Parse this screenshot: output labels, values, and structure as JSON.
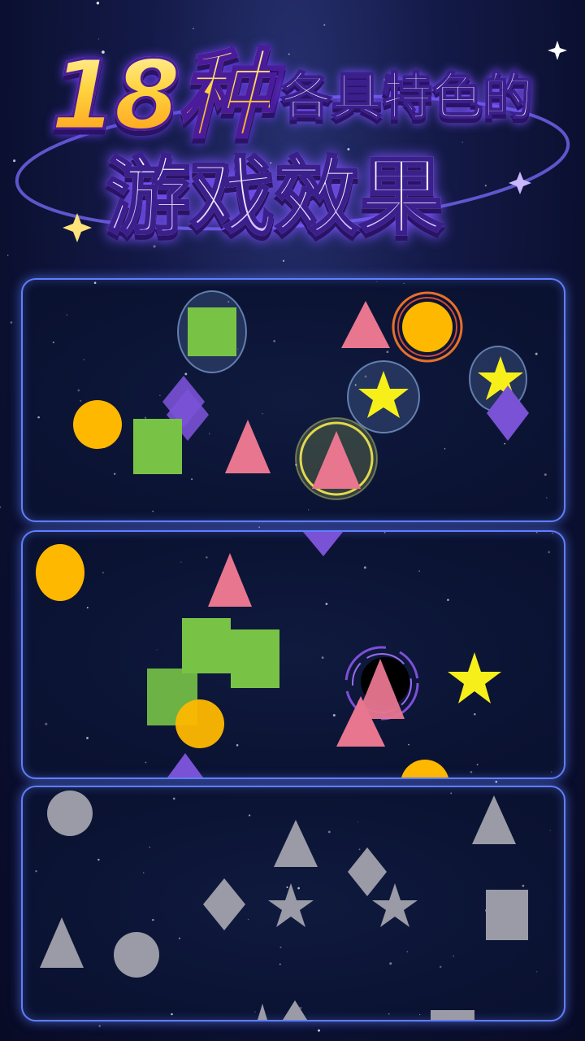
{
  "header": {
    "count_label": "18种",
    "subtitle": "各具特色的",
    "title": "游戏效果"
  },
  "colors": {
    "yellow": "#ffb800",
    "green": "#78c346",
    "pink": "#e8768f",
    "purple": "#7a52d6",
    "star": "#f7ef1a",
    "gray": "#9a9ba6",
    "panel_border": "#5f7fff"
  },
  "panels": [
    {
      "name": "effect-panel-1",
      "shapes": [
        {
          "type": "square",
          "color": "green",
          "effect": "bubble"
        },
        {
          "type": "triangle",
          "color": "pink"
        },
        {
          "type": "circle",
          "color": "yellow",
          "effect": "orange-ring"
        },
        {
          "type": "star",
          "color": "star",
          "effect": "bubble"
        },
        {
          "type": "star",
          "color": "star",
          "effect": "bubble"
        },
        {
          "type": "diamond",
          "color": "purple"
        },
        {
          "type": "diamond",
          "color": "purple"
        },
        {
          "type": "circle",
          "color": "yellow"
        },
        {
          "type": "square",
          "color": "green"
        },
        {
          "type": "triangle",
          "color": "pink"
        },
        {
          "type": "triangle",
          "color": "pink",
          "effect": "yellow-ring"
        }
      ]
    },
    {
      "name": "effect-panel-2",
      "shapes": [
        {
          "type": "circle",
          "color": "yellow"
        },
        {
          "type": "diamond",
          "color": "purple"
        },
        {
          "type": "triangle",
          "color": "pink"
        },
        {
          "type": "square",
          "color": "green"
        },
        {
          "type": "square",
          "color": "green"
        },
        {
          "type": "square",
          "color": "green"
        },
        {
          "type": "circle",
          "color": "yellow"
        },
        {
          "type": "black-hole",
          "color": "purple"
        },
        {
          "type": "triangle",
          "color": "pink"
        },
        {
          "type": "triangle",
          "color": "pink"
        },
        {
          "type": "star",
          "color": "star"
        },
        {
          "type": "circle",
          "color": "yellow"
        },
        {
          "type": "diamond",
          "color": "purple"
        }
      ]
    },
    {
      "name": "effect-panel-3",
      "shapes": [
        {
          "type": "circle",
          "color": "gray"
        },
        {
          "type": "triangle",
          "color": "gray"
        },
        {
          "type": "triangle",
          "color": "gray"
        },
        {
          "type": "diamond",
          "color": "gray"
        },
        {
          "type": "diamond",
          "color": "gray"
        },
        {
          "type": "star",
          "color": "gray"
        },
        {
          "type": "star",
          "color": "gray"
        },
        {
          "type": "square",
          "color": "gray"
        },
        {
          "type": "triangle",
          "color": "gray"
        },
        {
          "type": "circle",
          "color": "gray"
        },
        {
          "type": "triangle",
          "color": "gray"
        },
        {
          "type": "triangle",
          "color": "gray"
        },
        {
          "type": "square",
          "color": "gray"
        }
      ]
    }
  ]
}
